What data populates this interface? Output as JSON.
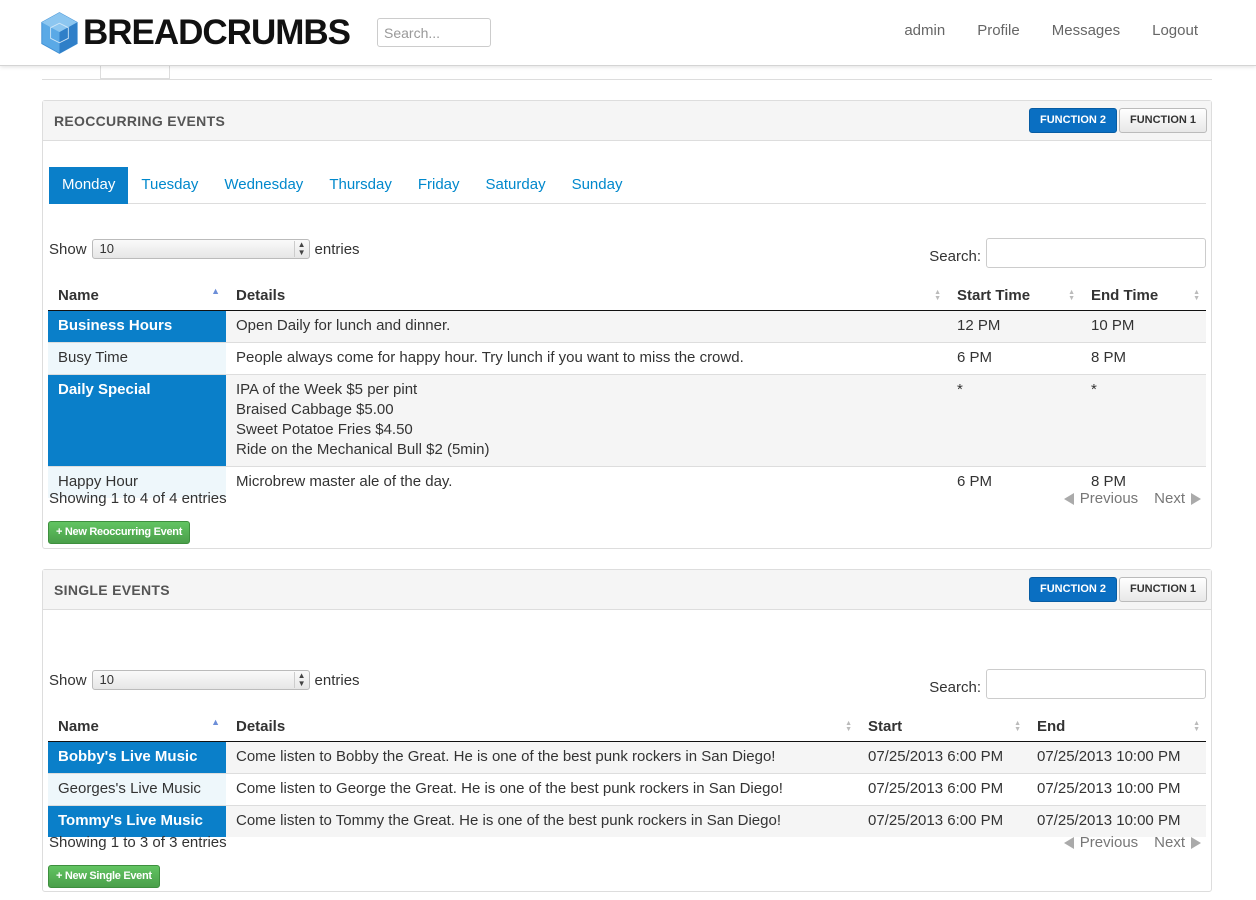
{
  "nav": {
    "brand": "BREADCRUMBS",
    "search_placeholder": "Search...",
    "links": [
      "admin",
      "Profile",
      "Messages",
      "Logout"
    ]
  },
  "reoccurring": {
    "title": "REOCCURRING EVENTS",
    "function2": "FUNCTION 2",
    "function1": "FUNCTION 1",
    "days": [
      "Monday",
      "Tuesday",
      "Wednesday",
      "Thursday",
      "Friday",
      "Saturday",
      "Sunday"
    ],
    "active_day": "Monday",
    "show_label": "Show",
    "entries_value": "10",
    "entries_label": "entries",
    "search_label": "Search:",
    "columns": [
      "Name",
      "Details",
      "Start Time",
      "End Time"
    ],
    "rows": [
      {
        "name": "Business Hours",
        "details": [
          "Open Daily for lunch and dinner."
        ],
        "start": "12 PM",
        "end": "10 PM"
      },
      {
        "name": "Busy Time",
        "details": [
          "People always come for happy hour. Try lunch if you want to miss the crowd."
        ],
        "start": "6 PM",
        "end": "8 PM"
      },
      {
        "name": "Daily Special",
        "details": [
          "IPA of the Week $5 per pint",
          "Braised Cabbage $5.00",
          "Sweet Potatoe Fries $4.50",
          "Ride on the Mechanical Bull $2 (5min)"
        ],
        "start": "*",
        "end": "*"
      },
      {
        "name": "Happy Hour",
        "details": [
          "Microbrew master ale of the day."
        ],
        "start": "6 PM",
        "end": "8 PM"
      }
    ],
    "info": "Showing 1 to 4 of 4 entries",
    "previous": "Previous",
    "next": "Next",
    "new_button": "+ New Reoccurring Event"
  },
  "single": {
    "title": "SINGLE EVENTS",
    "function2": "FUNCTION 2",
    "function1": "FUNCTION 1",
    "show_label": "Show",
    "entries_value": "10",
    "entries_label": "entries",
    "search_label": "Search:",
    "columns": [
      "Name",
      "Details",
      "Start",
      "End"
    ],
    "rows": [
      {
        "name": "Bobby's Live Music",
        "details": "Come listen to Bobby the Great. He is one of the best punk rockers in San Diego!",
        "start": "07/25/2013 6:00 PM",
        "end": "07/25/2013 10:00 PM"
      },
      {
        "name": "Georges's Live Music",
        "details": "Come listen to George the Great. He is one of the best punk rockers in San Diego!",
        "start": "07/25/2013 6:00 PM",
        "end": "07/25/2013 10:00 PM"
      },
      {
        "name": "Tommy's Live Music",
        "details": "Come listen to Tommy the Great. He is one of the best punk rockers in San Diego!",
        "start": "07/25/2013 6:00 PM",
        "end": "07/25/2013 10:00 PM"
      }
    ],
    "info": "Showing 1 to 3 of 3 entries",
    "previous": "Previous",
    "next": "Next",
    "new_button": "+ New Single Event"
  },
  "colors": {
    "primary": "#0a7fc9",
    "link": "#0088cc",
    "success": "#5bb75b"
  }
}
